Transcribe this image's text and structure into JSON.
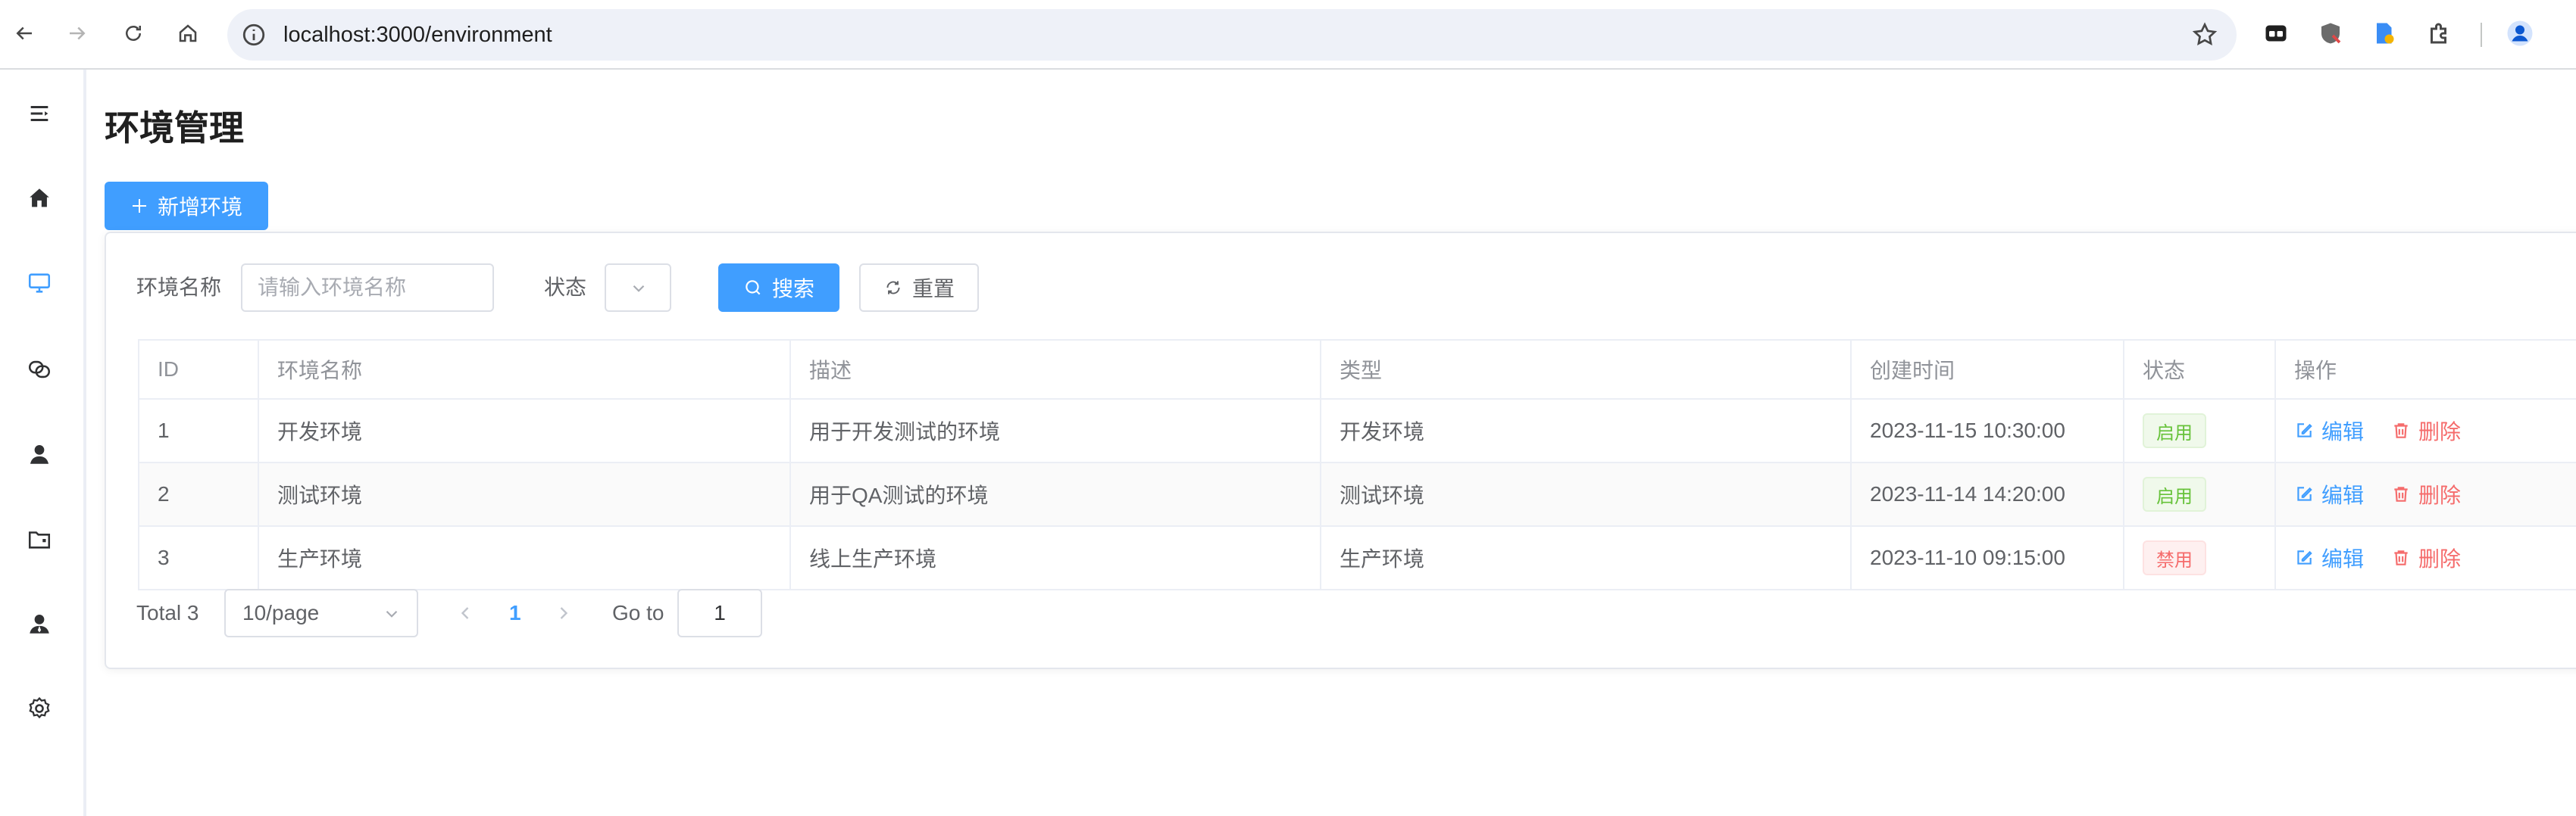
{
  "browser": {
    "url": "localhost:3000/environment"
  },
  "sidebar": {
    "items": [
      {
        "icon": "menu-icon"
      },
      {
        "icon": "home-icon"
      },
      {
        "icon": "monitor-icon",
        "active": true
      },
      {
        "icon": "link-icon"
      },
      {
        "icon": "user-icon"
      },
      {
        "icon": "folder-icon"
      },
      {
        "icon": "user-group-icon"
      },
      {
        "icon": "settings-icon"
      }
    ]
  },
  "page": {
    "title": "环境管理",
    "add_button": "新增环境"
  },
  "filters": {
    "name_label": "环境名称",
    "name_placeholder": "请输入环境名称",
    "status_label": "状态",
    "search_button": "搜索",
    "reset_button": "重置"
  },
  "table": {
    "columns": [
      "ID",
      "环境名称",
      "描述",
      "类型",
      "创建时间",
      "状态",
      "操作"
    ],
    "rows": [
      {
        "id": "1",
        "name": "开发环境",
        "desc": "用于开发测试的环境",
        "type": "开发环境",
        "created": "2023-11-15 10:30:00",
        "status": "启用",
        "enabled": true
      },
      {
        "id": "2",
        "name": "测试环境",
        "desc": "用于QA测试的环境",
        "type": "测试环境",
        "created": "2023-11-14 14:20:00",
        "status": "启用",
        "enabled": true
      },
      {
        "id": "3",
        "name": "生产环境",
        "desc": "线上生产环境",
        "type": "生产环境",
        "created": "2023-11-10 09:15:00",
        "status": "禁用",
        "enabled": false
      }
    ],
    "edit_label": "编辑",
    "delete_label": "删除"
  },
  "pagination": {
    "total": "Total 3",
    "page_size": "10/page",
    "current_page": "1",
    "goto_label": "Go to",
    "goto_value": "1"
  },
  "colors": {
    "primary": "#409eff",
    "success": "#67c23a",
    "danger": "#f56c6c"
  }
}
